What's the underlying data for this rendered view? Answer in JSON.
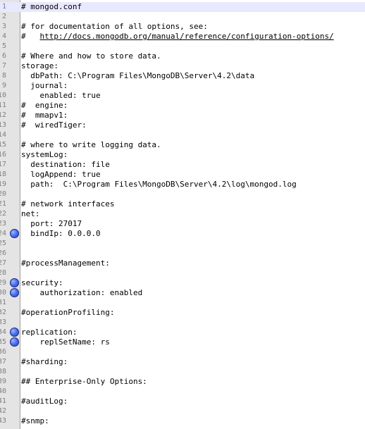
{
  "bookmark_icon": "blue-circle-bookmark",
  "current_line": 1,
  "lines": [
    {
      "n": "1",
      "text": "# mongod.conf",
      "bookmark": false
    },
    {
      "n": "2",
      "text": "",
      "bookmark": false
    },
    {
      "n": "3",
      "text": "# for documentation of all options, see:",
      "bookmark": false
    },
    {
      "n": "4",
      "text": "#   ",
      "link": "http://docs.mongodb.org/manual/reference/configuration-options/",
      "bookmark": false
    },
    {
      "n": "5",
      "text": "",
      "bookmark": false
    },
    {
      "n": "6",
      "text": "# Where and how to store data.",
      "bookmark": false
    },
    {
      "n": "7",
      "text": "storage:",
      "bookmark": false
    },
    {
      "n": "8",
      "text": "  dbPath: C:\\Program Files\\MongoDB\\Server\\4.2\\data",
      "bookmark": false
    },
    {
      "n": "9",
      "text": "  journal:",
      "bookmark": false
    },
    {
      "n": "10",
      "text": "    enabled: true",
      "bookmark": false
    },
    {
      "n": "11",
      "text": "#  engine:",
      "bookmark": false
    },
    {
      "n": "12",
      "text": "#  mmapv1:",
      "bookmark": false
    },
    {
      "n": "13",
      "text": "#  wiredTiger:",
      "bookmark": false
    },
    {
      "n": "14",
      "text": "",
      "bookmark": false
    },
    {
      "n": "15",
      "text": "# where to write logging data.",
      "bookmark": false
    },
    {
      "n": "16",
      "text": "systemLog:",
      "bookmark": false
    },
    {
      "n": "17",
      "text": "  destination: file",
      "bookmark": false
    },
    {
      "n": "18",
      "text": "  logAppend: true",
      "bookmark": false
    },
    {
      "n": "19",
      "text": "  path:  C:\\Program Files\\MongoDB\\Server\\4.2\\log\\mongod.log",
      "bookmark": false
    },
    {
      "n": "20",
      "text": "",
      "bookmark": false
    },
    {
      "n": "21",
      "text": "# network interfaces",
      "bookmark": false
    },
    {
      "n": "22",
      "text": "net:",
      "bookmark": false
    },
    {
      "n": "23",
      "text": "  port: 27017",
      "bookmark": false
    },
    {
      "n": "24",
      "text": "  bindIp: 0.0.0.0",
      "bookmark": true
    },
    {
      "n": "25",
      "text": "",
      "bookmark": false
    },
    {
      "n": "26",
      "text": "",
      "bookmark": false
    },
    {
      "n": "27",
      "text": "#processManagement:",
      "bookmark": false
    },
    {
      "n": "28",
      "text": "",
      "bookmark": false
    },
    {
      "n": "29",
      "text": "security:",
      "bookmark": true
    },
    {
      "n": "30",
      "text": "    authorization: enabled",
      "bookmark": true
    },
    {
      "n": "31",
      "text": "",
      "bookmark": false
    },
    {
      "n": "32",
      "text": "#operationProfiling:",
      "bookmark": false
    },
    {
      "n": "33",
      "text": "",
      "bookmark": false
    },
    {
      "n": "34",
      "text": "replication:",
      "bookmark": true
    },
    {
      "n": "35",
      "text": "    replSetName: rs",
      "bookmark": true
    },
    {
      "n": "36",
      "text": "",
      "bookmark": false
    },
    {
      "n": "37",
      "text": "#sharding:",
      "bookmark": false
    },
    {
      "n": "38",
      "text": "",
      "bookmark": false
    },
    {
      "n": "39",
      "text": "## Enterprise-Only Options:",
      "bookmark": false
    },
    {
      "n": "40",
      "text": "",
      "bookmark": false
    },
    {
      "n": "41",
      "text": "#auditLog:",
      "bookmark": false
    },
    {
      "n": "42",
      "text": "",
      "bookmark": false
    },
    {
      "n": "43",
      "text": "#snmp:",
      "bookmark": false
    }
  ]
}
